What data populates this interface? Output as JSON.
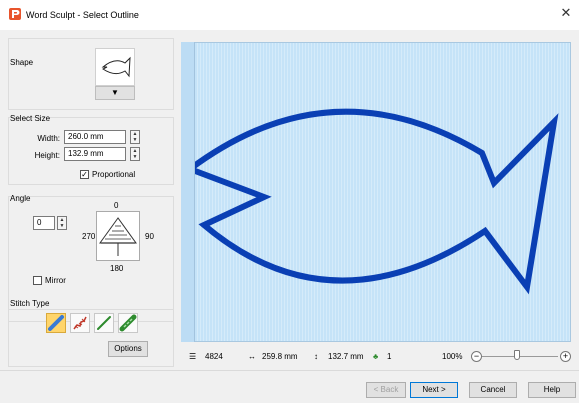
{
  "window": {
    "title": "Word Sculpt - Select Outline",
    "close_glyph": "✕"
  },
  "shape": {
    "label": "Shape",
    "dropdown_glyph": "▼",
    "selected_shape_icon": "fish-outline-icon"
  },
  "select_size": {
    "label": "Select Size",
    "width_label": "Width:",
    "width_value": "260.0 mm",
    "height_label": "Height:",
    "height_value": "132.9 mm",
    "proportional_label": "Proportional",
    "proportional_checked": true
  },
  "angle": {
    "label": "Angle",
    "value": "0",
    "dial_top": "0",
    "dial_left": "270",
    "dial_right": "90",
    "dial_bottom": "180",
    "mirror_label": "Mirror",
    "mirror_checked": false
  },
  "stitch_type": {
    "label": "Stitch Type",
    "options_button": "Options",
    "types": [
      {
        "icon": "satin-stitch-icon",
        "active": true
      },
      {
        "icon": "blackwork-stitch-icon",
        "active": false
      },
      {
        "icon": "running-stitch-icon",
        "active": false
      },
      {
        "icon": "motif-stitch-icon",
        "active": false
      }
    ]
  },
  "status": {
    "stitch_count": "4824",
    "width": "259.8 mm",
    "height": "132.7 mm",
    "colors": "1",
    "zoom": "100%"
  },
  "footer": {
    "back": "< Back",
    "next": "Next >",
    "cancel": "Cancel",
    "help": "Help"
  },
  "colors": {
    "outline": "#0a3fb4",
    "canvas": "#c5e3f8",
    "active_stitch": "#ffd56b"
  }
}
